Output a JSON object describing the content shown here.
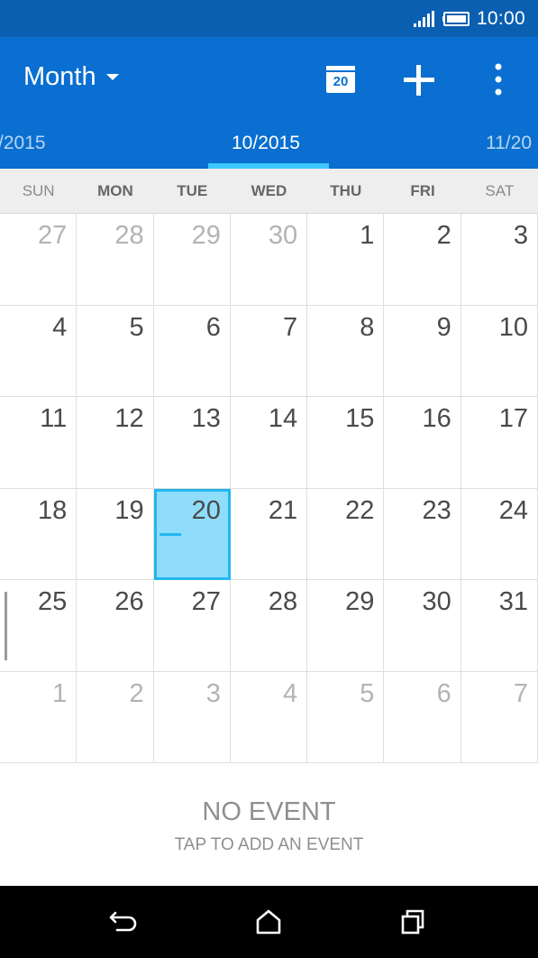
{
  "status_bar": {
    "time": "10:00",
    "signal_icon": "signal-icon",
    "battery_icon": "battery-icon"
  },
  "app_bar": {
    "view_label": "Month",
    "today_badge": "20",
    "icons": [
      "chevron-down-icon",
      "calendar-today-icon",
      "add-icon",
      "overflow-menu-icon"
    ]
  },
  "month_tabs": {
    "previous": "/2015",
    "current": "10/2015",
    "next": "11/20"
  },
  "weekdays": [
    "SUN",
    "MON",
    "TUE",
    "WED",
    "THU",
    "FRI",
    "SAT"
  ],
  "weeks": [
    [
      "27",
      "28",
      "29",
      "30",
      "1",
      "2",
      "3"
    ],
    [
      "4",
      "5",
      "6",
      "7",
      "8",
      "9",
      "10"
    ],
    [
      "11",
      "12",
      "13",
      "14",
      "15",
      "16",
      "17"
    ],
    [
      "18",
      "19",
      "20",
      "21",
      "22",
      "23",
      "24"
    ],
    [
      "25",
      "26",
      "27",
      "28",
      "29",
      "30",
      "31"
    ],
    [
      "1",
      "2",
      "3",
      "4",
      "5",
      "6",
      "7"
    ]
  ],
  "selected_day": "20",
  "events": {
    "empty_title": "NO EVENT",
    "empty_hint": "TAP TO ADD AN EVENT"
  },
  "colors": {
    "status_bar": "#0a5fb0",
    "app_bar": "#0a6fd0",
    "tab_indicator": "#3ec7ff",
    "today_fill": "#8fdcfb",
    "today_border": "#22b7ef"
  },
  "nav_bar": {
    "icons": [
      "back-icon",
      "home-icon",
      "recent-apps-icon"
    ]
  }
}
